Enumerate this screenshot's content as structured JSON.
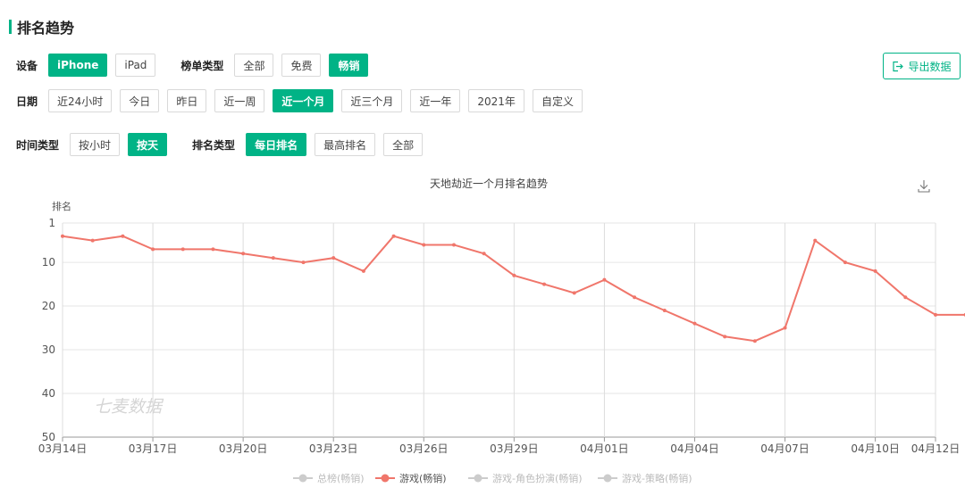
{
  "section": {
    "title": "排名趋势"
  },
  "filters": {
    "device": {
      "label": "设备",
      "options": [
        "iPhone",
        "iPad"
      ],
      "active": 0
    },
    "chart_type": {
      "label": "榜单类型",
      "options": [
        "全部",
        "免费",
        "畅销"
      ],
      "active": 2
    },
    "date": {
      "label": "日期",
      "options": [
        "近24小时",
        "今日",
        "昨日",
        "近一周",
        "近一个月",
        "近三个月",
        "近一年",
        "2021年",
        "自定义"
      ],
      "active": 4
    },
    "time_type": {
      "label": "时间类型",
      "options": [
        "按小时",
        "按天"
      ],
      "active": 1
    },
    "rank_type": {
      "label": "排名类型",
      "options": [
        "每日排名",
        "最高排名",
        "全部"
      ],
      "active": 0
    }
  },
  "export": {
    "label": "导出数据",
    "icon": "export-icon"
  },
  "accent_color": "#00b386",
  "watermark": "七麦数据",
  "chart_data": {
    "type": "line",
    "title": "天地劫近一个月排名趋势",
    "ylabel": "排名",
    "xlabel": "",
    "y_inverted": true,
    "ylim": [
      1,
      50
    ],
    "yticks": [
      1,
      10,
      20,
      30,
      40,
      50
    ],
    "x": [
      "03月14日",
      "03月15日",
      "03月16日",
      "03月17日",
      "03月18日",
      "03月19日",
      "03月20日",
      "03月21日",
      "03月22日",
      "03月23日",
      "03月24日",
      "03月25日",
      "03月26日",
      "03月27日",
      "03月28日",
      "03月29日",
      "03月30日",
      "03月31日",
      "04月01日",
      "04月02日",
      "04月03日",
      "04月04日",
      "04月05日",
      "04月06日",
      "04月07日",
      "04月08日",
      "04月09日",
      "04月10日",
      "04月11日",
      "04月12日"
    ],
    "xticks": [
      "03月14日",
      "03月17日",
      "03月20日",
      "03月23日",
      "03月26日",
      "03月29日",
      "04月01日",
      "04月04日",
      "04月07日",
      "04月10日",
      "04月12日"
    ],
    "grid": true,
    "legend_position": "bottom",
    "series": [
      {
        "name": "总榜(畅销)",
        "color": "#cccccc",
        "visible": false,
        "values": []
      },
      {
        "name": "游戏(畅销)",
        "color": "#f0766b",
        "visible": true,
        "values": [
          4,
          5,
          4,
          7,
          7,
          7,
          8,
          9,
          10,
          9,
          12,
          4,
          6,
          6,
          8,
          13,
          15,
          17,
          14,
          18,
          21,
          24,
          27,
          28,
          25,
          5,
          10,
          12,
          18,
          22,
          22
        ]
      },
      {
        "name": "游戏-角色扮演(畅销)",
        "color": "#cccccc",
        "visible": false,
        "values": []
      },
      {
        "name": "游戏-策略(畅销)",
        "color": "#cccccc",
        "visible": false,
        "values": []
      }
    ]
  }
}
